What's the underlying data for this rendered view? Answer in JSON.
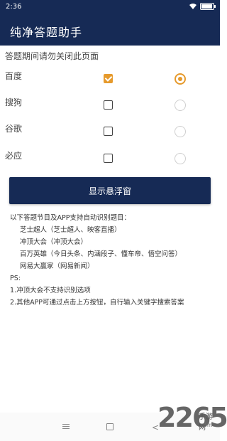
{
  "status_bar": {
    "time": "2:36"
  },
  "app": {
    "title": "纯净答题助手"
  },
  "notice": "答题期间请勿关闭此页面",
  "engines": [
    {
      "label": "百度",
      "checked": true,
      "selected": true
    },
    {
      "label": "搜狗",
      "checked": false,
      "selected": false
    },
    {
      "label": "谷歌",
      "checked": false,
      "selected": false
    },
    {
      "label": "必应",
      "checked": false,
      "selected": false
    }
  ],
  "float_button_label": "显示悬浮窗",
  "info": {
    "intro": "以下答题节目及APP支持自动识别题目：",
    "apps": [
      "芝士超人（芝士超人、映客直播）",
      "冲顶大会（冲顶大会）",
      "百万英雄（今日头条、内涵段子、懂车帝、悟空问答）",
      "网易大赢家（网易新闻）"
    ],
    "ps_title": "PS:",
    "ps_notes": [
      "1.冲顶大会不支持识别选项",
      "2.其他APP可通过点击上方按钮，自行输入关键字搜索答案"
    ]
  },
  "watermark": {
    "number": "2265",
    "site": "手游网",
    "domain": ".com"
  },
  "colors": {
    "primary": "#162a55",
    "accent": "#e69a2c"
  }
}
